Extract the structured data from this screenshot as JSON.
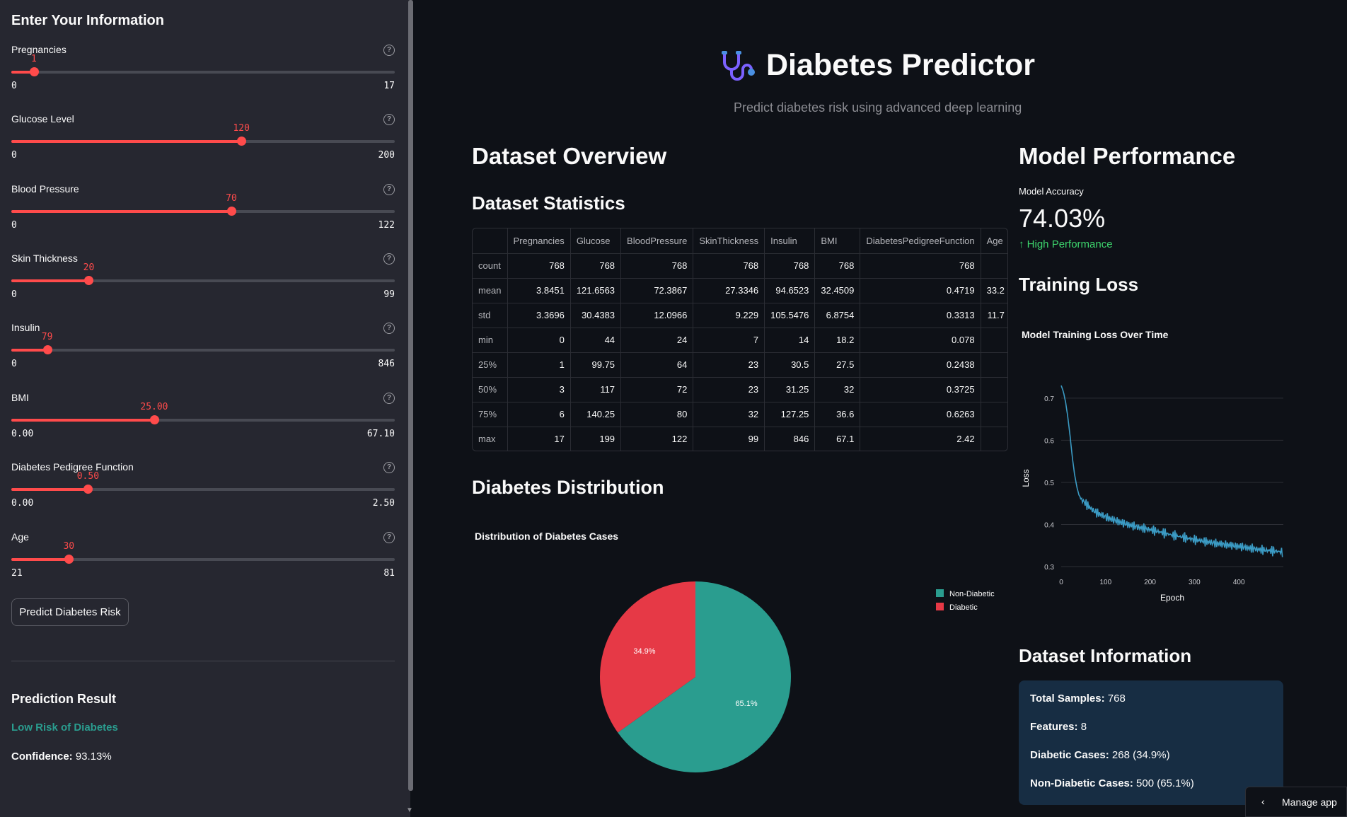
{
  "sidebar": {
    "title": "Enter Your Information",
    "help_glyph": "?",
    "sliders": [
      {
        "label": "Pregnancies",
        "value": "1",
        "min": "0",
        "max": "17",
        "fraction": 0.0588
      },
      {
        "label": "Glucose Level",
        "value": "120",
        "min": "0",
        "max": "200",
        "fraction": 0.6
      },
      {
        "label": "Blood Pressure",
        "value": "70",
        "min": "0",
        "max": "122",
        "fraction": 0.5738
      },
      {
        "label": "Skin Thickness",
        "value": "20",
        "min": "0",
        "max": "99",
        "fraction": 0.202
      },
      {
        "label": "Insulin",
        "value": "79",
        "min": "0",
        "max": "846",
        "fraction": 0.0934
      },
      {
        "label": "BMI",
        "value": "25.00",
        "min": "0.00",
        "max": "67.10",
        "fraction": 0.3726
      },
      {
        "label": "Diabetes Pedigree Function",
        "value": "0.50",
        "min": "0.00",
        "max": "2.50",
        "fraction": 0.2
      },
      {
        "label": "Age",
        "value": "30",
        "min": "21",
        "max": "81",
        "fraction": 0.15
      }
    ],
    "predict_button": "Predict Diabetes Risk",
    "prediction": {
      "title": "Prediction Result",
      "result": "Low Risk of Diabetes",
      "confidence_label": "Confidence:",
      "confidence_value": "93.13%"
    }
  },
  "header": {
    "title": "Diabetes Predictor",
    "subtitle": "Predict diabetes risk using advanced deep learning",
    "icon": "stethoscope-icon"
  },
  "dataset_overview": {
    "title": "Dataset Overview",
    "stats_title": "Dataset Statistics",
    "columns": [
      "",
      "Pregnancies",
      "Glucose",
      "BloodPressure",
      "SkinThickness",
      "Insulin",
      "BMI",
      "DiabetesPedigreeFunction",
      "Age"
    ],
    "rows": [
      [
        "count",
        "768",
        "768",
        "768",
        "768",
        "768",
        "768",
        "768",
        ""
      ],
      [
        "mean",
        "3.8451",
        "121.6563",
        "72.3867",
        "27.3346",
        "94.6523",
        "32.4509",
        "0.4719",
        "33.2"
      ],
      [
        "std",
        "3.3696",
        "30.4383",
        "12.0966",
        "9.229",
        "105.5476",
        "6.8754",
        "0.3313",
        "11.7"
      ],
      [
        "min",
        "0",
        "44",
        "24",
        "7",
        "14",
        "18.2",
        "0.078",
        ""
      ],
      [
        "25%",
        "1",
        "99.75",
        "64",
        "23",
        "30.5",
        "27.5",
        "0.2438",
        ""
      ],
      [
        "50%",
        "3",
        "117",
        "72",
        "23",
        "31.25",
        "32",
        "0.3725",
        ""
      ],
      [
        "75%",
        "6",
        "140.25",
        "80",
        "32",
        "127.25",
        "36.6",
        "0.6263",
        ""
      ],
      [
        "max",
        "17",
        "199",
        "122",
        "99",
        "846",
        "67.1",
        "2.42",
        ""
      ]
    ]
  },
  "distribution": {
    "title": "Diabetes Distribution"
  },
  "model_performance": {
    "title": "Model Performance",
    "metric_label": "Model Accuracy",
    "metric_value": "74.03%",
    "delta": "High Performance",
    "delta_icon": "arrow-up-icon",
    "loss_title": "Training Loss"
  },
  "dataset_info": {
    "title": "Dataset Information",
    "items": [
      {
        "label": "Total Samples:",
        "value": "768"
      },
      {
        "label": "Features:",
        "value": "8"
      },
      {
        "label": "Diabetic Cases:",
        "value": "268 (34.9%)"
      },
      {
        "label": "Non-Diabetic Cases:",
        "value": "500 (65.1%)"
      }
    ]
  },
  "manage_app": "Manage app",
  "colors": {
    "accent": "#ff4b4b",
    "non_diabetic": "#2a9d8f",
    "diabetic": "#e63946",
    "loss_line": "#3b9bc4",
    "positive": "#3dd56d"
  },
  "chart_data": [
    {
      "type": "pie",
      "title": "Distribution of Diabetes Cases",
      "labels": [
        "Non-Diabetic",
        "Diabetic"
      ],
      "values": [
        500,
        268
      ],
      "percent_labels": [
        "65.1%",
        "34.9%"
      ],
      "colors": [
        "#2a9d8f",
        "#e63946"
      ],
      "legend": "top-right"
    },
    {
      "type": "line",
      "title": "Model Training Loss Over Time",
      "xlabel": "Epoch",
      "ylabel": "Loss",
      "xlim": [
        0,
        500
      ],
      "ylim": [
        0.29,
        0.73
      ],
      "xticks": [
        0,
        100,
        200,
        300,
        400
      ],
      "yticks": [
        0.3,
        0.4,
        0.5,
        0.6,
        0.7
      ],
      "grid": true,
      "series": [
        {
          "x": [
            0,
            5,
            10,
            15,
            20,
            25,
            30,
            35,
            40,
            45,
            50,
            60,
            70,
            80,
            100,
            120,
            150,
            180,
            200,
            250,
            300,
            350,
            400,
            450,
            499
          ],
          "y": [
            0.73,
            0.715,
            0.69,
            0.655,
            0.61,
            0.56,
            0.52,
            0.49,
            0.47,
            0.46,
            0.455,
            0.445,
            0.435,
            0.428,
            0.418,
            0.41,
            0.4,
            0.392,
            0.388,
            0.375,
            0.364,
            0.355,
            0.348,
            0.34,
            0.335
          ]
        }
      ]
    }
  ]
}
